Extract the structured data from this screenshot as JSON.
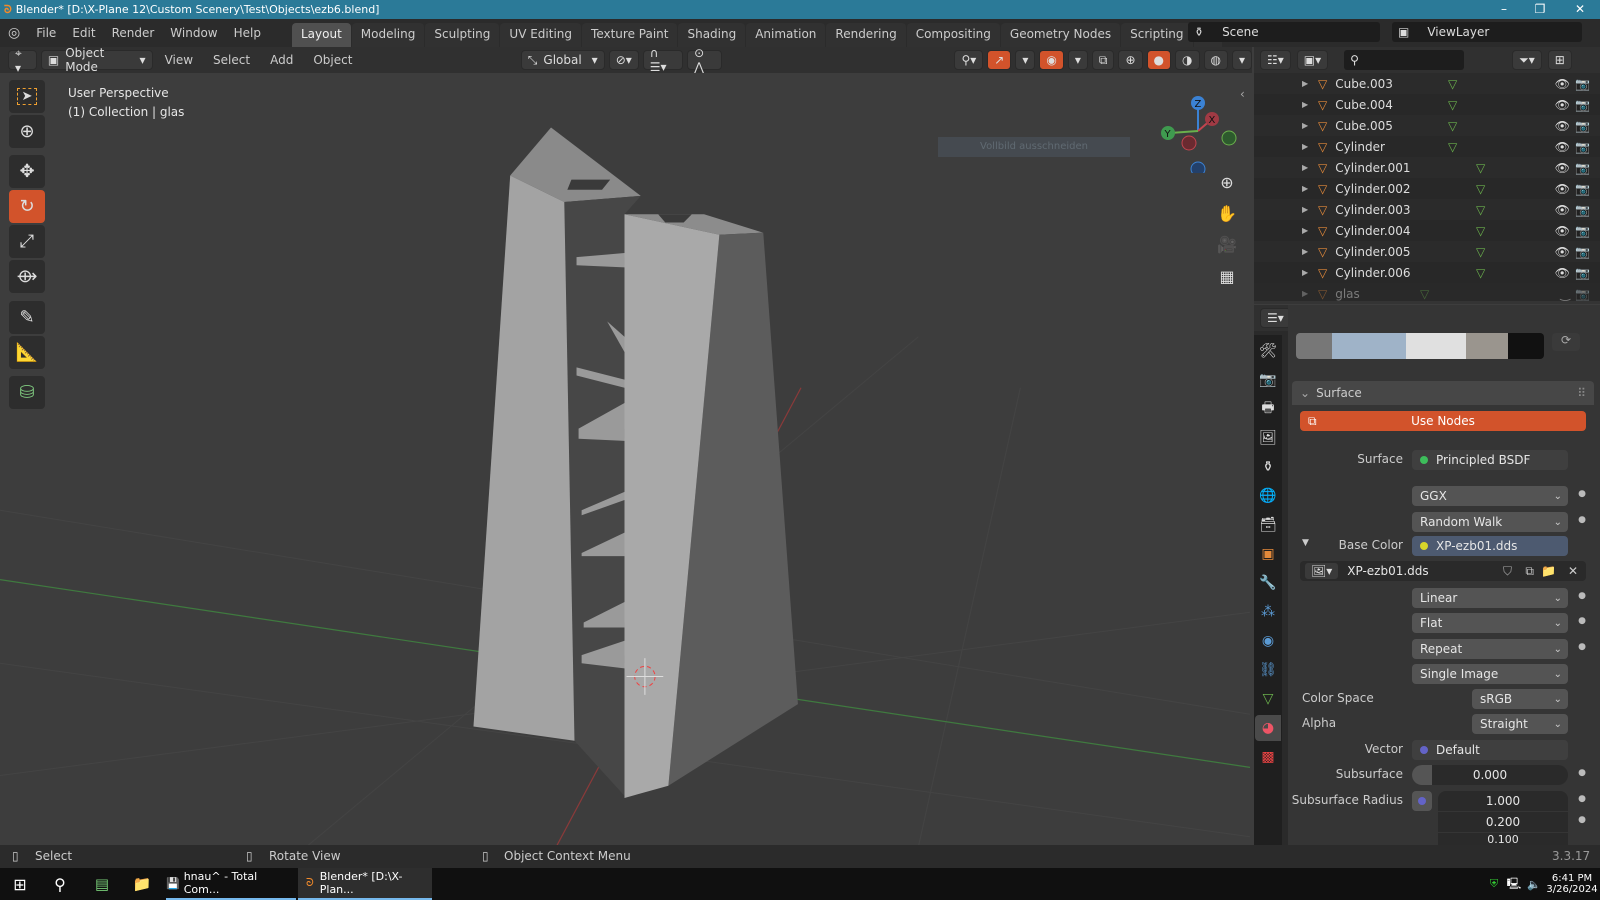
{
  "window": {
    "title": "Blender* [D:\\X-Plane 12\\Custom Scenery\\Test\\Objects\\ezb6.blend]",
    "minimize": "–",
    "maximize": "❐",
    "close": "✕"
  },
  "menu": [
    "File",
    "Edit",
    "Render",
    "Window",
    "Help"
  ],
  "workspaces": [
    "Layout",
    "Modeling",
    "Sculpting",
    "UV Editing",
    "Texture Paint",
    "Shading",
    "Animation",
    "Rendering",
    "Compositing",
    "Geometry Nodes",
    "Scripting"
  ],
  "active_workspace": "Layout",
  "add_workspace": "+",
  "scene": {
    "label": "Scene",
    "view_layer": "ViewLayer"
  },
  "viewport_header": {
    "mode": "Object Mode",
    "menus": [
      "View",
      "Select",
      "Add",
      "Object"
    ],
    "orientation": "Global"
  },
  "viewport": {
    "perspective": "User Perspective",
    "collection": "(1) Collection | glas",
    "tooltip": "Vollbild ausschneiden",
    "axes": {
      "x": "X",
      "y": "Y",
      "z": "Z"
    }
  },
  "outliner": {
    "items": [
      {
        "name": "Cube.003",
        "visible": true
      },
      {
        "name": "Cube.004",
        "visible": true
      },
      {
        "name": "Cube.005",
        "visible": true
      },
      {
        "name": "Cylinder",
        "visible": true
      },
      {
        "name": "Cylinder.001",
        "visible": true
      },
      {
        "name": "Cylinder.002",
        "visible": true
      },
      {
        "name": "Cylinder.003",
        "visible": true
      },
      {
        "name": "Cylinder.004",
        "visible": true
      },
      {
        "name": "Cylinder.005",
        "visible": true
      },
      {
        "name": "Cylinder.006",
        "visible": true
      },
      {
        "name": "glas",
        "visible": false
      }
    ]
  },
  "properties": {
    "panel": "Surface",
    "use_nodes": "Use Nodes",
    "surface_label": "Surface",
    "surface_value": "Principled BSDF",
    "distribution": "GGX",
    "subsurface_method": "Random Walk",
    "base_color_label": "Base Color",
    "base_color_value": "XP-ezb01.dds",
    "image_name": "XP-ezb01.dds",
    "interpolation": "Linear",
    "projection": "Flat",
    "extension": "Repeat",
    "source": "Single Image",
    "color_space_label": "Color Space",
    "color_space": "sRGB",
    "alpha_label": "Alpha",
    "alpha": "Straight",
    "vector_label": "Vector",
    "vector_value": "Default",
    "subsurface_label": "Subsurface",
    "subsurface_value": "0.000",
    "subsurface_radius_label": "Subsurface Radius",
    "subsurface_radius": [
      "1.000",
      "0.200",
      "0.100"
    ]
  },
  "statusbar": {
    "select": "Select",
    "rotate": "Rotate View",
    "context": "Object Context Menu",
    "version": "3.3.17"
  },
  "taskbar": {
    "apps": [
      {
        "label": "hnau^ - Total Com..."
      },
      {
        "label": "Blender* [D:\\X-Plan..."
      }
    ],
    "time": "6:41 PM",
    "date": "3/26/2024"
  },
  "colors": {
    "accent": "#d2532b",
    "titlebar": "#2b7a98",
    "x_axis": "#c2454f",
    "y_axis": "#6ab04c",
    "z_axis": "#3b82d4"
  }
}
